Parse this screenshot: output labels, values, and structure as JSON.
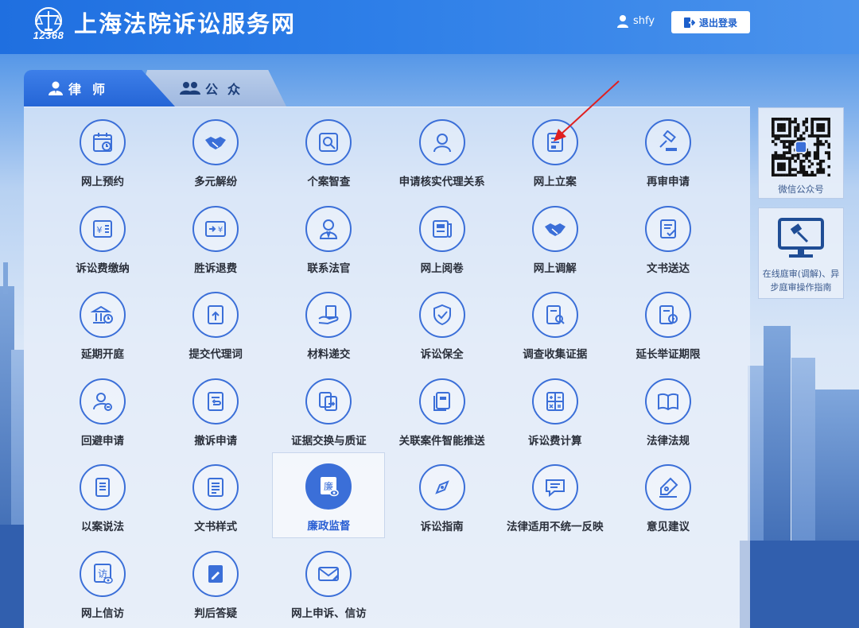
{
  "header": {
    "logo_number": "12368",
    "title": "上海法院诉讼服务网",
    "username": "shfy",
    "logout_label": "退出登录"
  },
  "tabs": [
    {
      "label": "律师",
      "active": true,
      "icon": "lawyer-icon"
    },
    {
      "label": "公众",
      "active": false,
      "icon": "people-icon"
    }
  ],
  "services": [
    {
      "label": "网上预约",
      "icon": "calendar-icon"
    },
    {
      "label": "多元解纷",
      "icon": "handshake-icon"
    },
    {
      "label": "个案智查",
      "icon": "search-icon"
    },
    {
      "label": "申请核实代理关系",
      "icon": "person-icon"
    },
    {
      "label": "网上立案",
      "icon": "case-file-icon"
    },
    {
      "label": "再审申请",
      "icon": "gavel-icon"
    },
    {
      "label": "诉讼费缴纳",
      "icon": "yuan-icon"
    },
    {
      "label": "胜诉退费",
      "icon": "refund-icon"
    },
    {
      "label": "联系法官",
      "icon": "judge-icon"
    },
    {
      "label": "网上阅卷",
      "icon": "newspaper-icon"
    },
    {
      "label": "网上调解",
      "icon": "handshake-icon"
    },
    {
      "label": "文书送达",
      "icon": "document-check-icon"
    },
    {
      "label": "延期开庭",
      "icon": "courthouse-clock-icon"
    },
    {
      "label": "提交代理词",
      "icon": "upload-document-icon"
    },
    {
      "label": "材料递交",
      "icon": "hand-document-icon"
    },
    {
      "label": "诉讼保全",
      "icon": "shield-check-icon"
    },
    {
      "label": "调查收集证据",
      "icon": "document-search-icon"
    },
    {
      "label": "延长举证期限",
      "icon": "document-clock-icon"
    },
    {
      "label": "回避申请",
      "icon": "person-minus-icon"
    },
    {
      "label": "撤诉申请",
      "icon": "document-return-icon"
    },
    {
      "label": "证据交换与质证",
      "icon": "document-exchange-icon"
    },
    {
      "label": "关联案件智能推送",
      "icon": "documents-icon"
    },
    {
      "label": "诉讼费计算",
      "icon": "calculator-icon"
    },
    {
      "label": "法律法规",
      "icon": "book-open-icon"
    },
    {
      "label": "以案说法",
      "icon": "book-icon"
    },
    {
      "label": "文书样式",
      "icon": "document-lines-icon"
    },
    {
      "label": "廉政监督",
      "icon": "integrity-icon",
      "active": true,
      "glyph": "廉"
    },
    {
      "label": "诉讼指南",
      "icon": "compass-icon"
    },
    {
      "label": "法律适用不统一反映",
      "icon": "chat-icon"
    },
    {
      "label": "意见建议",
      "icon": "pen-icon"
    },
    {
      "label": "网上信访",
      "icon": "visit-icon",
      "glyph": "访"
    },
    {
      "label": "判后答疑",
      "icon": "edit-document-icon"
    },
    {
      "label": "网上申诉、信访",
      "icon": "mail-icon"
    }
  ],
  "sidebar": {
    "qr_label": "微信公众号",
    "court_label": "在线庭审(调解)、异步庭审操作指南"
  },
  "colors": {
    "accent": "#3b6fd8",
    "header": "#2e7fe8"
  }
}
